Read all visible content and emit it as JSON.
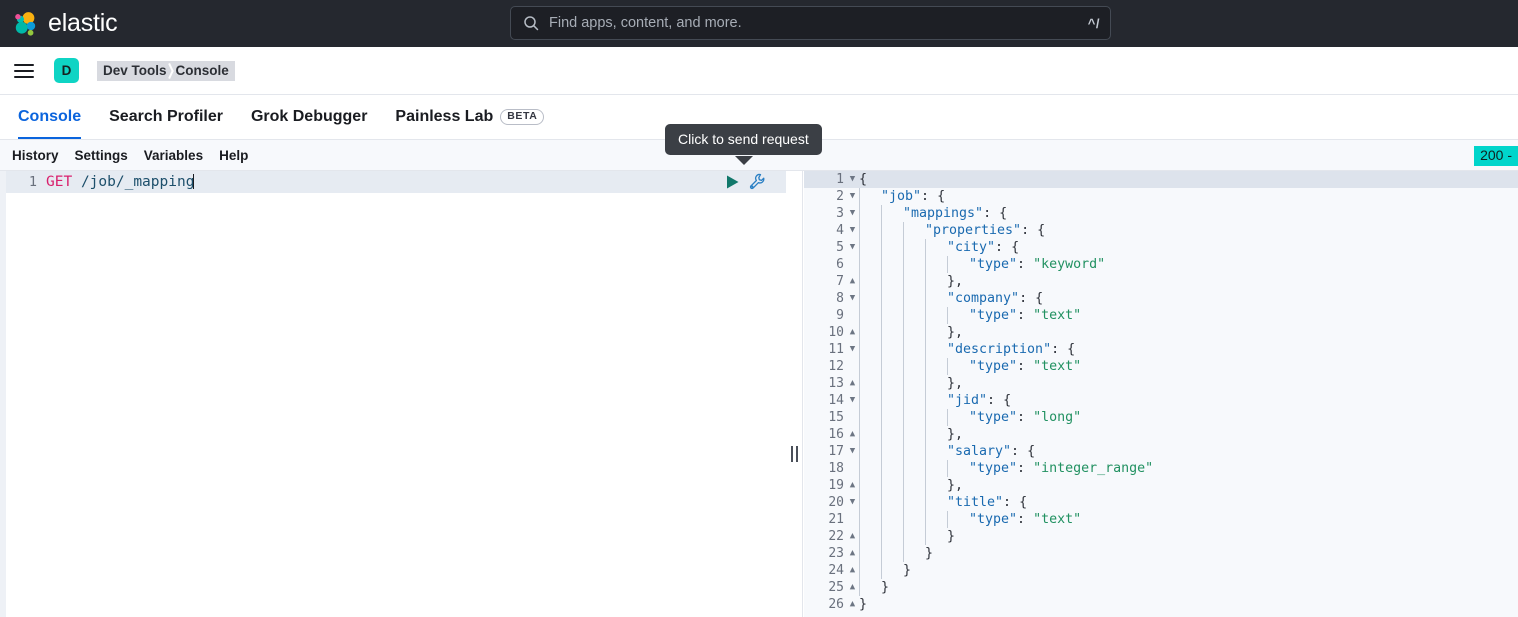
{
  "header": {
    "brand_name": "elastic",
    "logo_icon": "elastic-logo",
    "search": {
      "icon": "search-icon",
      "placeholder": "Find apps, content, and more.",
      "shortcut": "^/"
    }
  },
  "breadcrumb_bar": {
    "menu_icon": "hamburger-menu-icon",
    "avatar_initial": "D",
    "crumbs": [
      "Dev Tools",
      "Console"
    ]
  },
  "tabs": [
    {
      "label": "Console",
      "active": true,
      "badge": ""
    },
    {
      "label": "Search Profiler",
      "active": false,
      "badge": ""
    },
    {
      "label": "Grok Debugger",
      "active": false,
      "badge": ""
    },
    {
      "label": "Painless Lab",
      "active": false,
      "badge": "BETA"
    }
  ],
  "console_menu": {
    "items": [
      "History",
      "Settings",
      "Variables",
      "Help"
    ],
    "status_badge": "200 -"
  },
  "tooltip": {
    "text": "Click to send request"
  },
  "request_editor": {
    "line_number": "1",
    "method": "GET",
    "path": "/job/_mapping",
    "play_icon": "play-triangle-icon",
    "wrench_icon": "wrench-icon"
  },
  "response_editor": {
    "lines": [
      {
        "n": "1",
        "fold": "v",
        "indent": 0,
        "text": "{"
      },
      {
        "n": "2",
        "fold": "v",
        "indent": 1,
        "text": "\"job\": {",
        "key": "\"job\""
      },
      {
        "n": "3",
        "fold": "v",
        "indent": 2,
        "text": "\"mappings\": {",
        "key": "\"mappings\""
      },
      {
        "n": "4",
        "fold": "v",
        "indent": 3,
        "text": "\"properties\": {",
        "key": "\"properties\""
      },
      {
        "n": "5",
        "fold": "v",
        "indent": 4,
        "text": "\"city\": {",
        "key": "\"city\""
      },
      {
        "n": "6",
        "fold": "",
        "indent": 5,
        "text": "\"type\": \"keyword\"",
        "key": "\"type\"",
        "val": "\"keyword\""
      },
      {
        "n": "7",
        "fold": "^",
        "indent": 4,
        "text": "},"
      },
      {
        "n": "8",
        "fold": "v",
        "indent": 4,
        "text": "\"company\": {",
        "key": "\"company\""
      },
      {
        "n": "9",
        "fold": "",
        "indent": 5,
        "text": "\"type\": \"text\"",
        "key": "\"type\"",
        "val": "\"text\""
      },
      {
        "n": "10",
        "fold": "^",
        "indent": 4,
        "text": "},"
      },
      {
        "n": "11",
        "fold": "v",
        "indent": 4,
        "text": "\"description\": {",
        "key": "\"description\""
      },
      {
        "n": "12",
        "fold": "",
        "indent": 5,
        "text": "\"type\": \"text\"",
        "key": "\"type\"",
        "val": "\"text\""
      },
      {
        "n": "13",
        "fold": "^",
        "indent": 4,
        "text": "},"
      },
      {
        "n": "14",
        "fold": "v",
        "indent": 4,
        "text": "\"jid\": {",
        "key": "\"jid\""
      },
      {
        "n": "15",
        "fold": "",
        "indent": 5,
        "text": "\"type\": \"long\"",
        "key": "\"type\"",
        "val": "\"long\""
      },
      {
        "n": "16",
        "fold": "^",
        "indent": 4,
        "text": "},"
      },
      {
        "n": "17",
        "fold": "v",
        "indent": 4,
        "text": "\"salary\": {",
        "key": "\"salary\""
      },
      {
        "n": "18",
        "fold": "",
        "indent": 5,
        "text": "\"type\": \"integer_range\"",
        "key": "\"type\"",
        "val": "\"integer_range\""
      },
      {
        "n": "19",
        "fold": "^",
        "indent": 4,
        "text": "},"
      },
      {
        "n": "20",
        "fold": "v",
        "indent": 4,
        "text": "\"title\": {",
        "key": "\"title\""
      },
      {
        "n": "21",
        "fold": "",
        "indent": 5,
        "text": "\"type\": \"text\"",
        "key": "\"type\"",
        "val": "\"text\""
      },
      {
        "n": "22",
        "fold": "^",
        "indent": 4,
        "text": "}"
      },
      {
        "n": "23",
        "fold": "^",
        "indent": 3,
        "text": "}"
      },
      {
        "n": "24",
        "fold": "^",
        "indent": 2,
        "text": "}"
      },
      {
        "n": "25",
        "fold": "^",
        "indent": 1,
        "text": "}"
      },
      {
        "n": "26",
        "fold": "^",
        "indent": 0,
        "text": "}"
      }
    ]
  },
  "colors": {
    "header_bg": "#25282f",
    "accent_blue": "#0b64dd",
    "avatar_teal": "#0fd4c4",
    "status_teal": "#00d5cb",
    "method_pink": "#d9206d",
    "json_key_blue": "#1a6ab0",
    "json_string_green": "#219161",
    "play_green": "#11786b"
  }
}
